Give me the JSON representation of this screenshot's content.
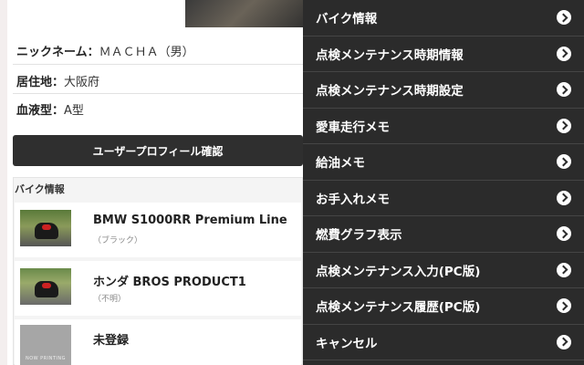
{
  "profile": {
    "nickname_label": "ニックネーム：",
    "nickname_value": "ＭＡＣＨＡ（男）",
    "residence_label": "居住地：",
    "residence_value": "大阪府",
    "blood_label": "血液型：",
    "blood_value": "A型",
    "confirm_button": "ユーザープロフィール確認"
  },
  "bikes": {
    "section_title": "バイク情報",
    "items": [
      {
        "name": "BMW S1000RR Premium Line",
        "sub": "（ブラック）"
      },
      {
        "name": "ホンダ BROS PRODUCT1",
        "sub": "（不明）"
      },
      {
        "name": "未登録",
        "sub": "",
        "thumb_text": "NOW PRINTING"
      }
    ]
  },
  "menu": {
    "items": [
      {
        "label": "バイク情報"
      },
      {
        "label": "点検メンテナンス時期情報"
      },
      {
        "label": "点検メンテナンス時期設定"
      },
      {
        "label": "愛車走行メモ"
      },
      {
        "label": "給油メモ"
      },
      {
        "label": "お手入れメモ"
      },
      {
        "label": "燃費グラフ表示"
      },
      {
        "label": "点検メンテナンス入力(PC版)"
      },
      {
        "label": "点検メンテナンス履歴(PC版)"
      },
      {
        "label": "キャンセル"
      }
    ]
  },
  "icons": {
    "menu_chevron": "chevron-right-icon"
  },
  "colors": {
    "menu_background": "#2b2b2b",
    "button_background": "#2f2f2f"
  }
}
